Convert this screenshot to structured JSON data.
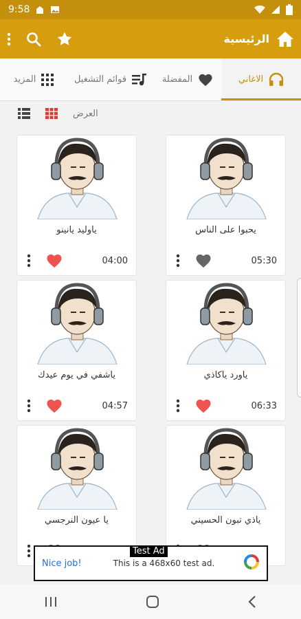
{
  "status": {
    "time": "9:58"
  },
  "appbar": {
    "title": "الرئيسية"
  },
  "tabs": [
    {
      "id": "songs",
      "label": "الاغاني",
      "icon": "headphones-icon"
    },
    {
      "id": "fav",
      "label": "المفضلة",
      "icon": "heart-icon"
    },
    {
      "id": "play",
      "label": "قوائم التشغيل",
      "icon": "playlist-icon"
    },
    {
      "id": "more",
      "label": "المزيد",
      "icon": "grid-icon"
    }
  ],
  "view": {
    "label": "العرض"
  },
  "songs": [
    {
      "title": "يحبوا على الناس",
      "duration": "05:30",
      "favorite": false
    },
    {
      "title": "ياوليد يانينو",
      "duration": "04:00",
      "favorite": true
    },
    {
      "title": "ياورد ياكاذي",
      "duration": "06:33",
      "favorite": true
    },
    {
      "title": "ياشفي في يوم عيدك",
      "duration": "04:57",
      "favorite": true
    },
    {
      "title": "ياذي تبون الحسيني",
      "duration": "",
      "favorite": false
    },
    {
      "title": "يا عيون النرجسي",
      "duration": "",
      "favorite": false
    }
  ],
  "ad": {
    "badge": "Test Ad",
    "nice": "Nice job!",
    "text": "This is a 468x60 test ad."
  },
  "colors": {
    "accent": "#d69e0f",
    "heart_red": "#ef5350",
    "heart_gray": "#666666"
  }
}
